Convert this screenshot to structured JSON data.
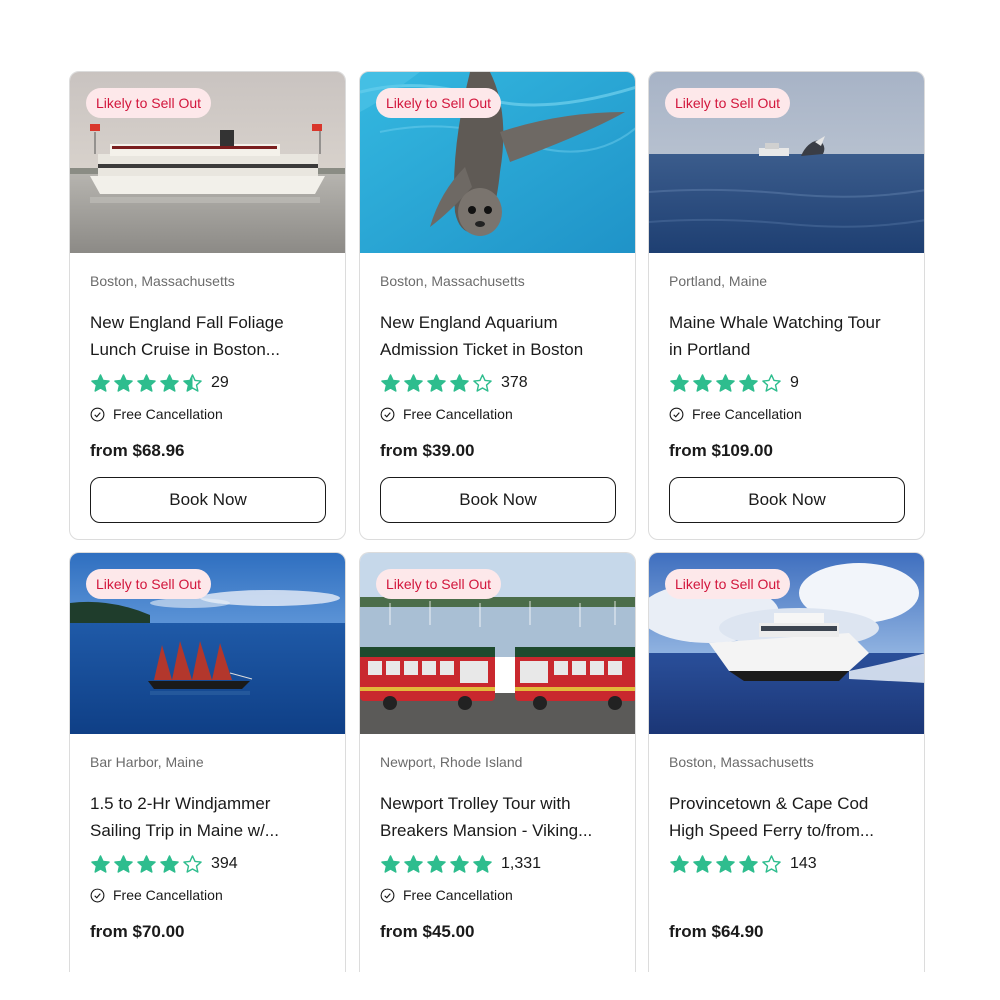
{
  "colors": {
    "star": "#2ebd8e",
    "badge_text": "#d2163c",
    "badge_bg": "#fde8ea"
  },
  "cards": [
    {
      "badge": "Likely to Sell Out",
      "location": "Boston, Massachusetts",
      "title_line1": "New England Fall Foliage",
      "title_line2": "Lunch Cruise in Boston...",
      "rating": 4.5,
      "reviews": "29",
      "cancellation": "Free Cancellation",
      "price": "from $68.96",
      "button": "Book Now",
      "image": "cruise-ship-photo"
    },
    {
      "badge": "Likely to Sell Out",
      "location": "Boston, Massachusetts",
      "title_line1": "New England Aquarium",
      "title_line2": "Admission Ticket in Boston",
      "rating": 4,
      "reviews": "378",
      "cancellation": "Free Cancellation",
      "price": "from $39.00",
      "button": "Book Now",
      "image": "seal-underwater-photo"
    },
    {
      "badge": "Likely to Sell Out",
      "location": "Portland, Maine",
      "title_line1": "Maine Whale Watching Tour",
      "title_line2": "in Portland",
      "rating": 4,
      "reviews": "9",
      "cancellation": "Free Cancellation",
      "price": "from $109.00",
      "button": "Book Now",
      "image": "whale-watching-photo"
    },
    {
      "badge": "Likely to Sell Out",
      "location": "Bar Harbor, Maine",
      "title_line1": "1.5 to 2-Hr Windjammer",
      "title_line2": "Sailing Trip in Maine w/...",
      "rating": 4,
      "reviews": "394",
      "cancellation": "Free Cancellation",
      "price": "from $70.00",
      "image": "windjammer-photo"
    },
    {
      "badge": "Likely to Sell Out",
      "location": "Newport, Rhode Island",
      "title_line1": "Newport Trolley Tour with",
      "title_line2": "Breakers Mansion - Viking...",
      "rating": 5,
      "reviews": "1,331",
      "cancellation": "Free Cancellation",
      "price": "from $45.00",
      "image": "trolleys-photo"
    },
    {
      "badge": "Likely to Sell Out",
      "location": "Boston, Massachusetts",
      "title_line1": "Provincetown & Cape Cod",
      "title_line2": "High Speed Ferry to/from...",
      "rating": 4,
      "reviews": "143",
      "cancellation": "",
      "price": "from $64.90",
      "image": "ferry-photo"
    }
  ]
}
